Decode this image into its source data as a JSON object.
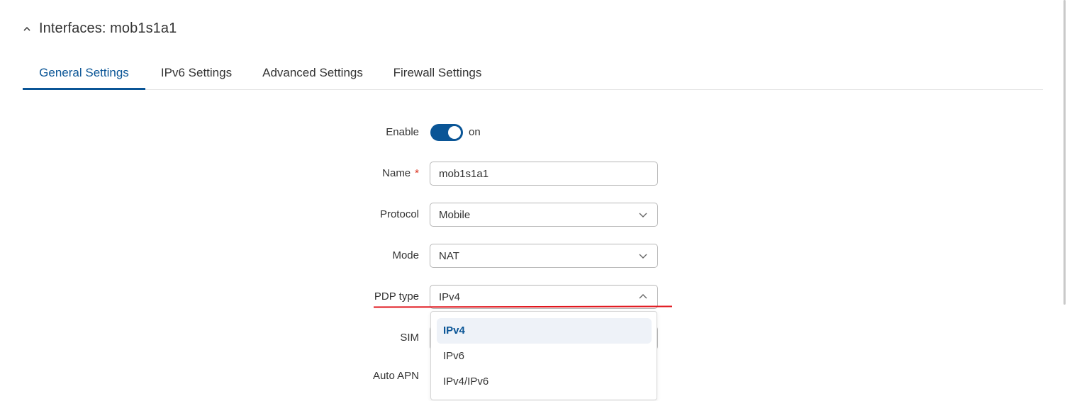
{
  "section": {
    "title": "Interfaces: mob1s1a1"
  },
  "tabs": [
    {
      "label": "General Settings",
      "active": true
    },
    {
      "label": "IPv6 Settings",
      "active": false
    },
    {
      "label": "Advanced Settings",
      "active": false
    },
    {
      "label": "Firewall Settings",
      "active": false
    }
  ],
  "form": {
    "enable": {
      "label": "Enable",
      "state": "on",
      "checked": true
    },
    "name": {
      "label": "Name",
      "required_mark": "*",
      "value": "mob1s1a1"
    },
    "protocol": {
      "label": "Protocol",
      "value": "Mobile"
    },
    "mode": {
      "label": "Mode",
      "value": "NAT"
    },
    "pdp_type": {
      "label": "PDP type",
      "value": "IPv4",
      "options": [
        "IPv4",
        "IPv6",
        "IPv4/IPv6"
      ],
      "selected_index": 0
    },
    "sim": {
      "label": "SIM"
    },
    "auto_apn": {
      "label": "Auto APN"
    }
  },
  "colors": {
    "accent": "#0a5596",
    "annotation_line": "#e0141b",
    "required": "#d9301d"
  },
  "icons": {
    "collapse": "chevron-up-icon",
    "select_closed": "chevron-down-icon",
    "select_open": "chevron-up-icon"
  }
}
